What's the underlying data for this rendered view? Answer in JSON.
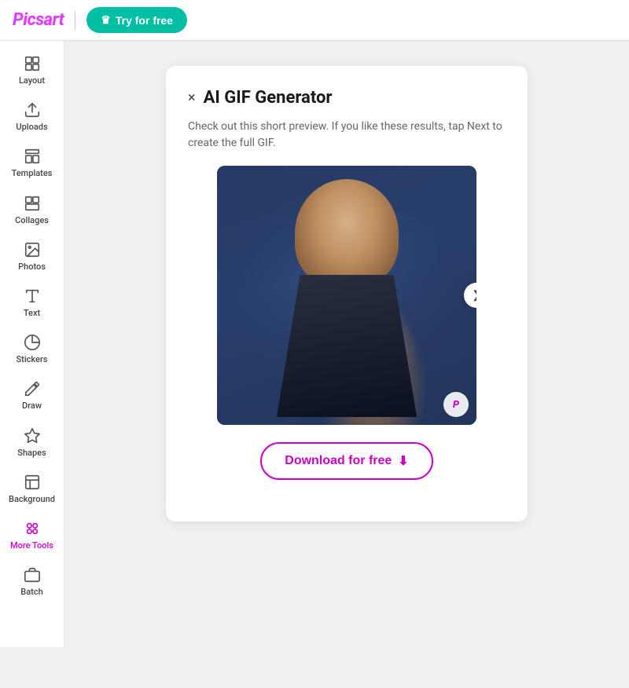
{
  "topnav": {
    "logo": "Picsart",
    "divider": true,
    "try_button_label": "Try for free",
    "crown_icon": "crown-icon"
  },
  "sidebar": {
    "items": [
      {
        "id": "layout",
        "label": "Layout",
        "icon": "layout-icon"
      },
      {
        "id": "uploads",
        "label": "Uploads",
        "icon": "upload-icon"
      },
      {
        "id": "templates",
        "label": "Templates",
        "icon": "templates-icon"
      },
      {
        "id": "collages",
        "label": "Collages",
        "icon": "collages-icon"
      },
      {
        "id": "photos",
        "label": "Photos",
        "icon": "photos-icon"
      },
      {
        "id": "text",
        "label": "Text",
        "icon": "text-icon"
      },
      {
        "id": "stickers",
        "label": "Stickers",
        "icon": "stickers-icon"
      },
      {
        "id": "draw",
        "label": "Draw",
        "icon": "draw-icon"
      },
      {
        "id": "shapes",
        "label": "Shapes",
        "icon": "shapes-icon"
      },
      {
        "id": "background",
        "label": "Background",
        "icon": "background-icon"
      },
      {
        "id": "more-tools",
        "label": "More Tools",
        "icon": "more-tools-icon",
        "active": true
      },
      {
        "id": "batch",
        "label": "Batch",
        "icon": "batch-icon"
      }
    ]
  },
  "panel": {
    "title": "AI GIF Generator",
    "description": "Check out this short preview. If you like these results, tap Next to create the full GIF.",
    "close_label": "×",
    "watermark": "P",
    "download_button_label": "Download for free",
    "chevron_label": "❯"
  }
}
